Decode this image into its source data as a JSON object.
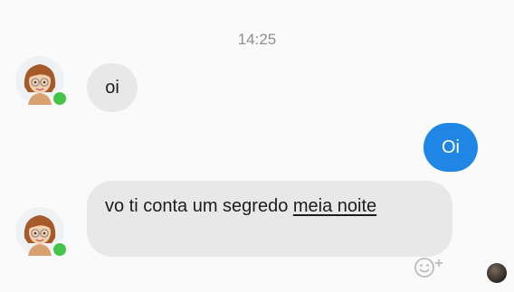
{
  "conversation": {
    "timestamp": "14:25",
    "messages": [
      {
        "sender": "contact",
        "text": "oi"
      },
      {
        "sender": "me",
        "text": "Oi"
      },
      {
        "sender": "contact",
        "text_plain": "vo ti conta um segredo ",
        "text_link": "meia noite"
      }
    ]
  },
  "icons": {
    "contact_avatar": "cartoon-woman-avatar",
    "online_status": "online-dot-icon",
    "reaction": "add-reaction-icon",
    "seen_by": "seen-avatar"
  },
  "colors": {
    "background": "#fafafa",
    "incoming_bubble": "#e8e8e9",
    "outgoing_bubble": "#1f86e6",
    "online": "#44c54a",
    "timestamp_text": "#8e8e93"
  }
}
